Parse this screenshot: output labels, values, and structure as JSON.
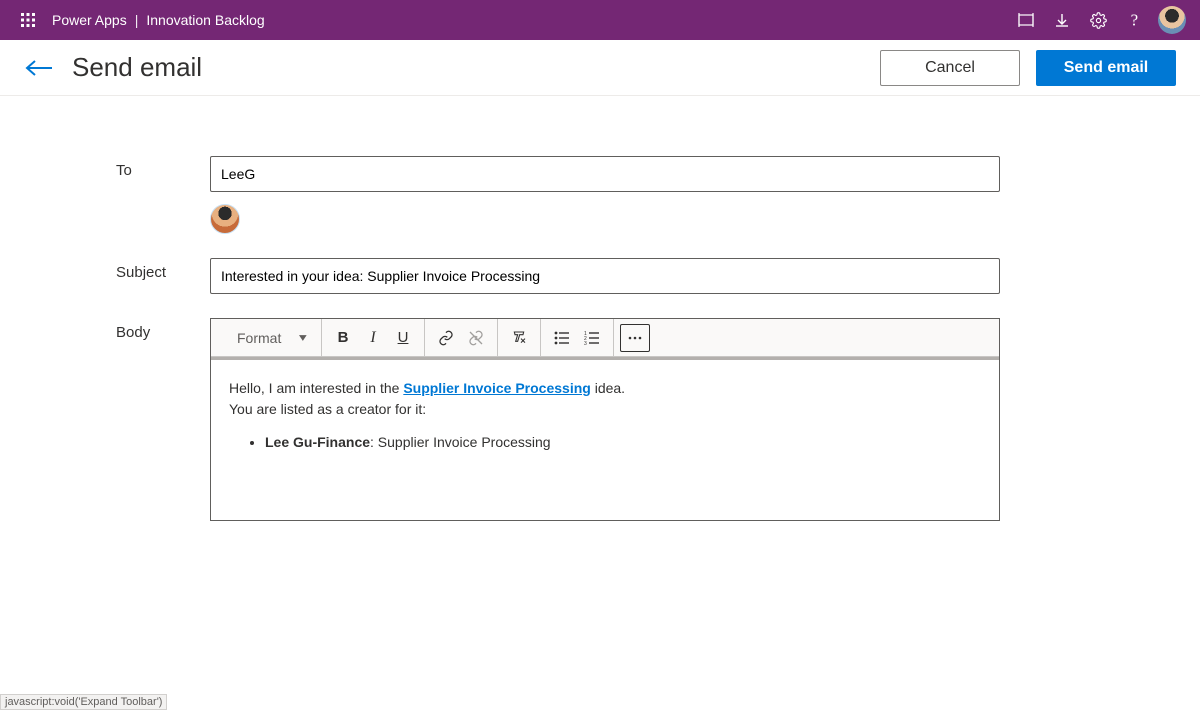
{
  "topbar": {
    "product": "Power Apps",
    "app_name": "Innovation Backlog"
  },
  "page": {
    "title": "Send email",
    "cancel_label": "Cancel",
    "send_label": "Send email"
  },
  "form": {
    "to_label": "To",
    "to_value": "LeeG",
    "subject_label": "Subject",
    "subject_value": "Interested in your idea: Supplier Invoice Processing",
    "body_label": "Body",
    "toolbar": {
      "format_label": "Format"
    },
    "body": {
      "line1_prefix": "Hello, I am interested in the ",
      "link_text": "Supplier Invoice Processing",
      "line1_suffix": " idea.",
      "line2": "You are listed as a creator for it:",
      "bullet_bold": "Lee Gu-Finance",
      "bullet_rest": ": Supplier Invoice Processing"
    }
  },
  "status_text": "javascript:void('Expand Toolbar')"
}
